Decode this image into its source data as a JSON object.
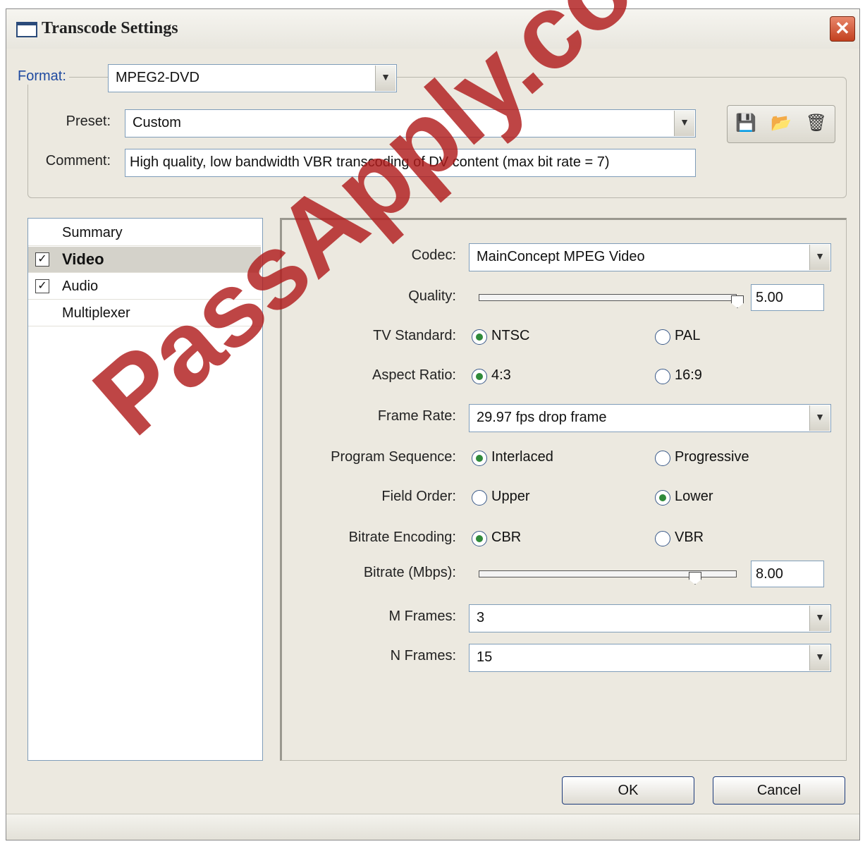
{
  "window": {
    "title": "Transcode Settings",
    "close_glyph": "✕"
  },
  "format": {
    "label": "Format:",
    "value": "MPEG2-DVD"
  },
  "preset": {
    "label": "Preset:",
    "value": "Custom"
  },
  "comment": {
    "label": "Comment:",
    "value": "High quality, low bandwidth VBR transcoding of DV content (max bit rate = 7)"
  },
  "preset_buttons": {
    "save_icon": "save-icon",
    "open_icon": "open-folder-icon",
    "delete_icon": "delete-icon"
  },
  "sidebar": {
    "items": [
      {
        "label": "Summary",
        "checkbox": false,
        "checked": false,
        "selected": false
      },
      {
        "label": "Video",
        "checkbox": true,
        "checked": true,
        "selected": true
      },
      {
        "label": "Audio",
        "checkbox": true,
        "checked": true,
        "selected": false
      },
      {
        "label": "Multiplexer",
        "checkbox": false,
        "checked": false,
        "selected": false
      }
    ]
  },
  "video": {
    "codec": {
      "label": "Codec:",
      "value": "MainConcept MPEG Video"
    },
    "quality": {
      "label": "Quality:",
      "value": "5.00",
      "slider_fraction": 1.0
    },
    "tv_standard": {
      "label": "TV Standard:",
      "options": [
        "NTSC",
        "PAL"
      ],
      "selected": "NTSC"
    },
    "aspect_ratio": {
      "label": "Aspect Ratio:",
      "options": [
        "4:3",
        "16:9"
      ],
      "selected": "4:3"
    },
    "frame_rate": {
      "label": "Frame Rate:",
      "value": "29.97 fps drop frame"
    },
    "program_sequence": {
      "label": "Program Sequence:",
      "options": [
        "Interlaced",
        "Progressive"
      ],
      "selected": "Interlaced"
    },
    "field_order": {
      "label": "Field Order:",
      "options": [
        "Upper",
        "Lower"
      ],
      "selected": "Lower"
    },
    "bitrate_encoding": {
      "label": "Bitrate Encoding:",
      "options": [
        "CBR",
        "VBR"
      ],
      "selected": "CBR"
    },
    "bitrate": {
      "label": "Bitrate (Mbps):",
      "value": "8.00",
      "slider_fraction": 0.83
    },
    "m_frames": {
      "label": "M Frames:",
      "value": "3"
    },
    "n_frames": {
      "label": "N Frames:",
      "value": "15"
    }
  },
  "buttons": {
    "ok": "OK",
    "cancel": "Cancel"
  },
  "watermark": "PassApply.com",
  "colors": {
    "watermark": "#b01c1c",
    "accent": "#1f4aa0",
    "radio_on": "#2f8a3a"
  }
}
